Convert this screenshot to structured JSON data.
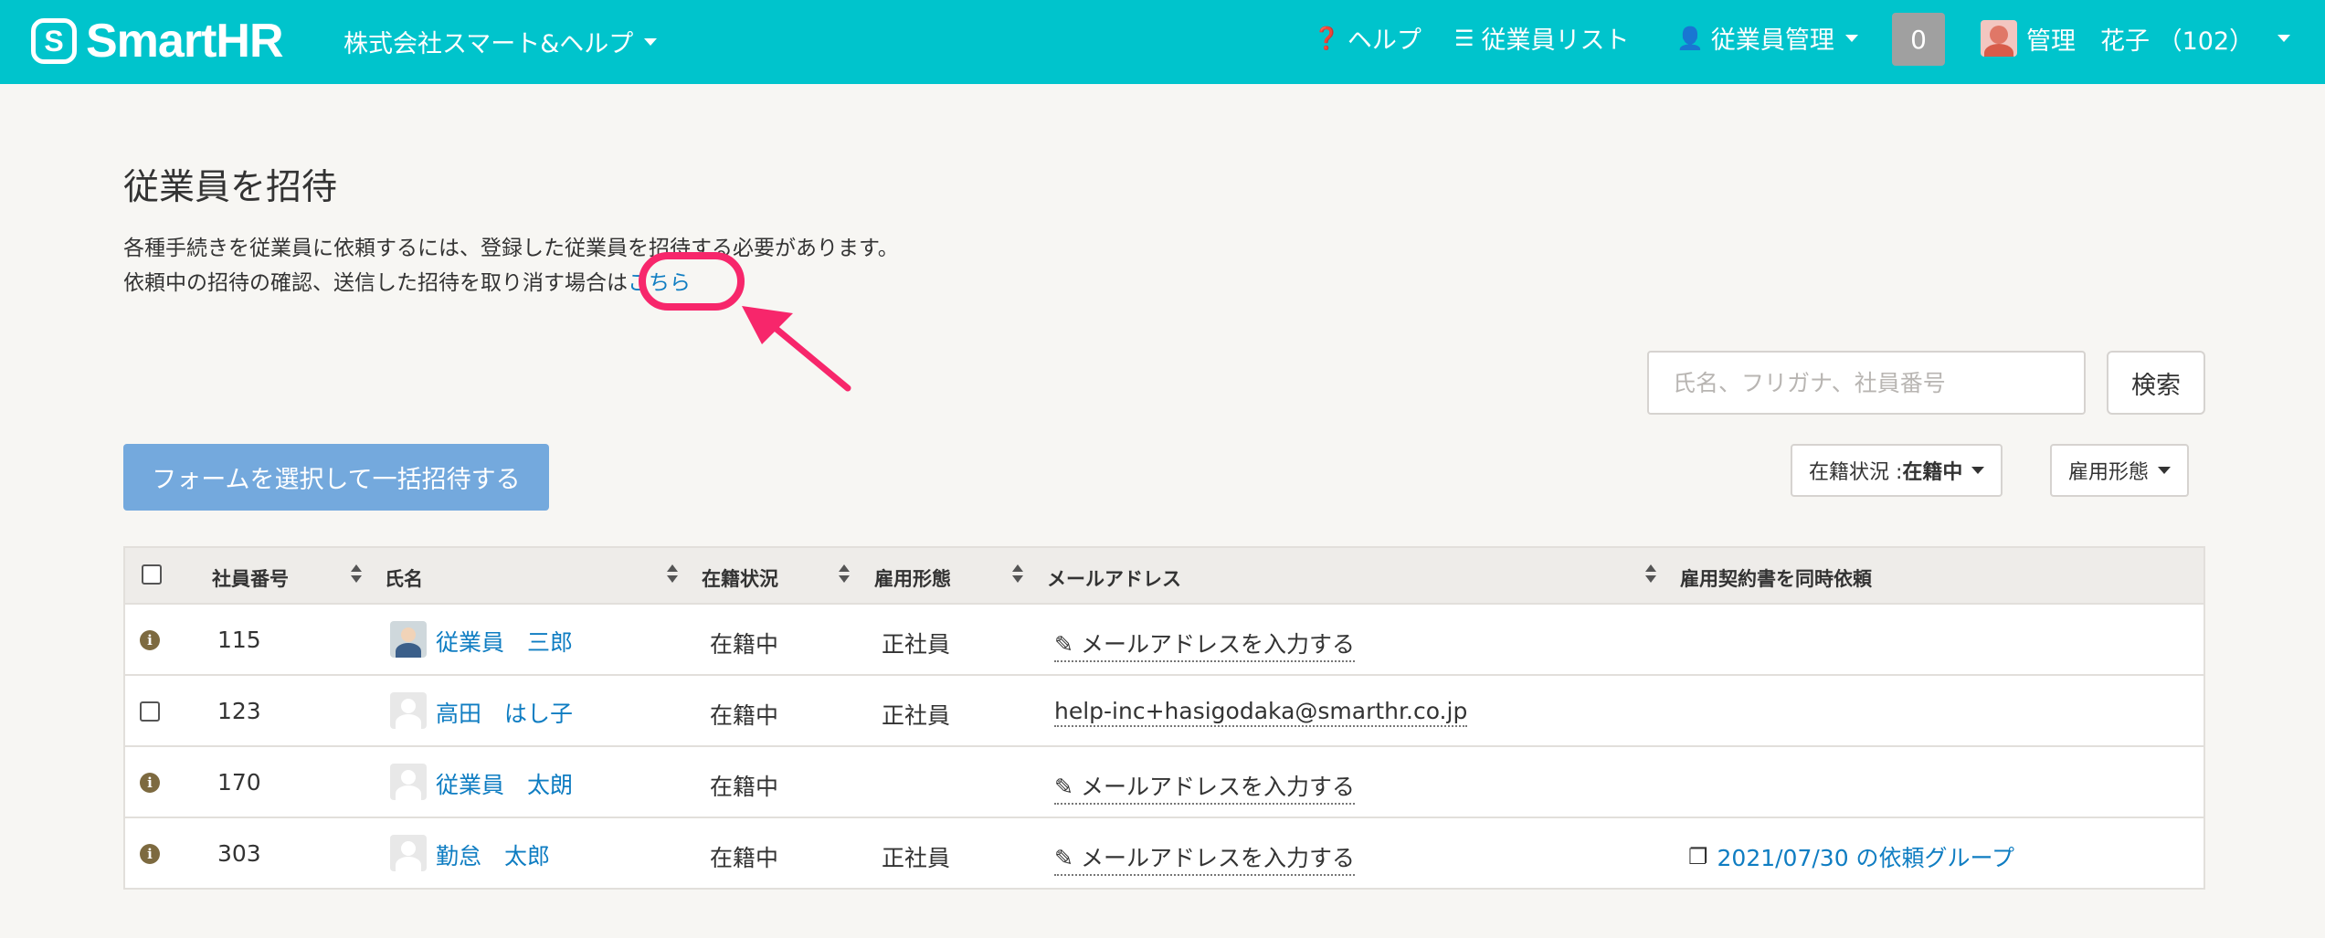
{
  "header": {
    "logo_text": "SmartHR",
    "company": "株式会社スマート&ヘルプ",
    "nav": [
      {
        "icon": "question-circle-icon",
        "label": "ヘルプ"
      },
      {
        "icon": "list-icon",
        "label": "従業員リスト"
      },
      {
        "icon": "user-icon",
        "label": "従業員管理"
      }
    ],
    "notification_count": "0",
    "user_name": "管理　花子 （102）",
    "bg_color": "#00c4cc"
  },
  "page": {
    "title": "従業員を招待",
    "desc_line1": "各種手続きを従業員に依頼するには、登録した従業員を招待する必要があります。",
    "desc_line2": "依頼中の招待の確認、送信した招待を取り消す場合は",
    "desc_link": "こちら",
    "annotation_color": "#f7266b"
  },
  "search": {
    "placeholder": "氏名、フリガナ、社員番号",
    "button": "検索"
  },
  "bulk_invite_button": "フォームを選択して一括招待する",
  "filters": {
    "status_label": "在籍状況 : ",
    "status_value": "在籍中",
    "employment_type": "雇用形態"
  },
  "table": {
    "columns": [
      "社員番号",
      "氏名",
      "在籍状況",
      "雇用形態",
      "メールアドレス",
      "雇用契約書を同時依頼"
    ],
    "rows": [
      {
        "leading": "info",
        "number": "115",
        "name": "従業員　三郎",
        "status": "在籍中",
        "type": "正社員",
        "email": "メールアドレスを入力する",
        "email_set": false,
        "request": ""
      },
      {
        "leading": "checkbox",
        "number": "123",
        "name": "高田　はし子",
        "status": "在籍中",
        "type": "正社員",
        "email": "help-inc+hasigodaka@smarthr.co.jp",
        "email_set": true,
        "request": ""
      },
      {
        "leading": "info",
        "number": "170",
        "name": "従業員　太朗",
        "status": "在籍中",
        "type": "",
        "email": "メールアドレスを入力する",
        "email_set": false,
        "request": ""
      },
      {
        "leading": "info",
        "number": "303",
        "name": "勤怠　太郎",
        "status": "在籍中",
        "type": "正社員",
        "email": "メールアドレスを入力する",
        "email_set": false,
        "request": "2021/07/30 の依頼グループ"
      }
    ]
  }
}
